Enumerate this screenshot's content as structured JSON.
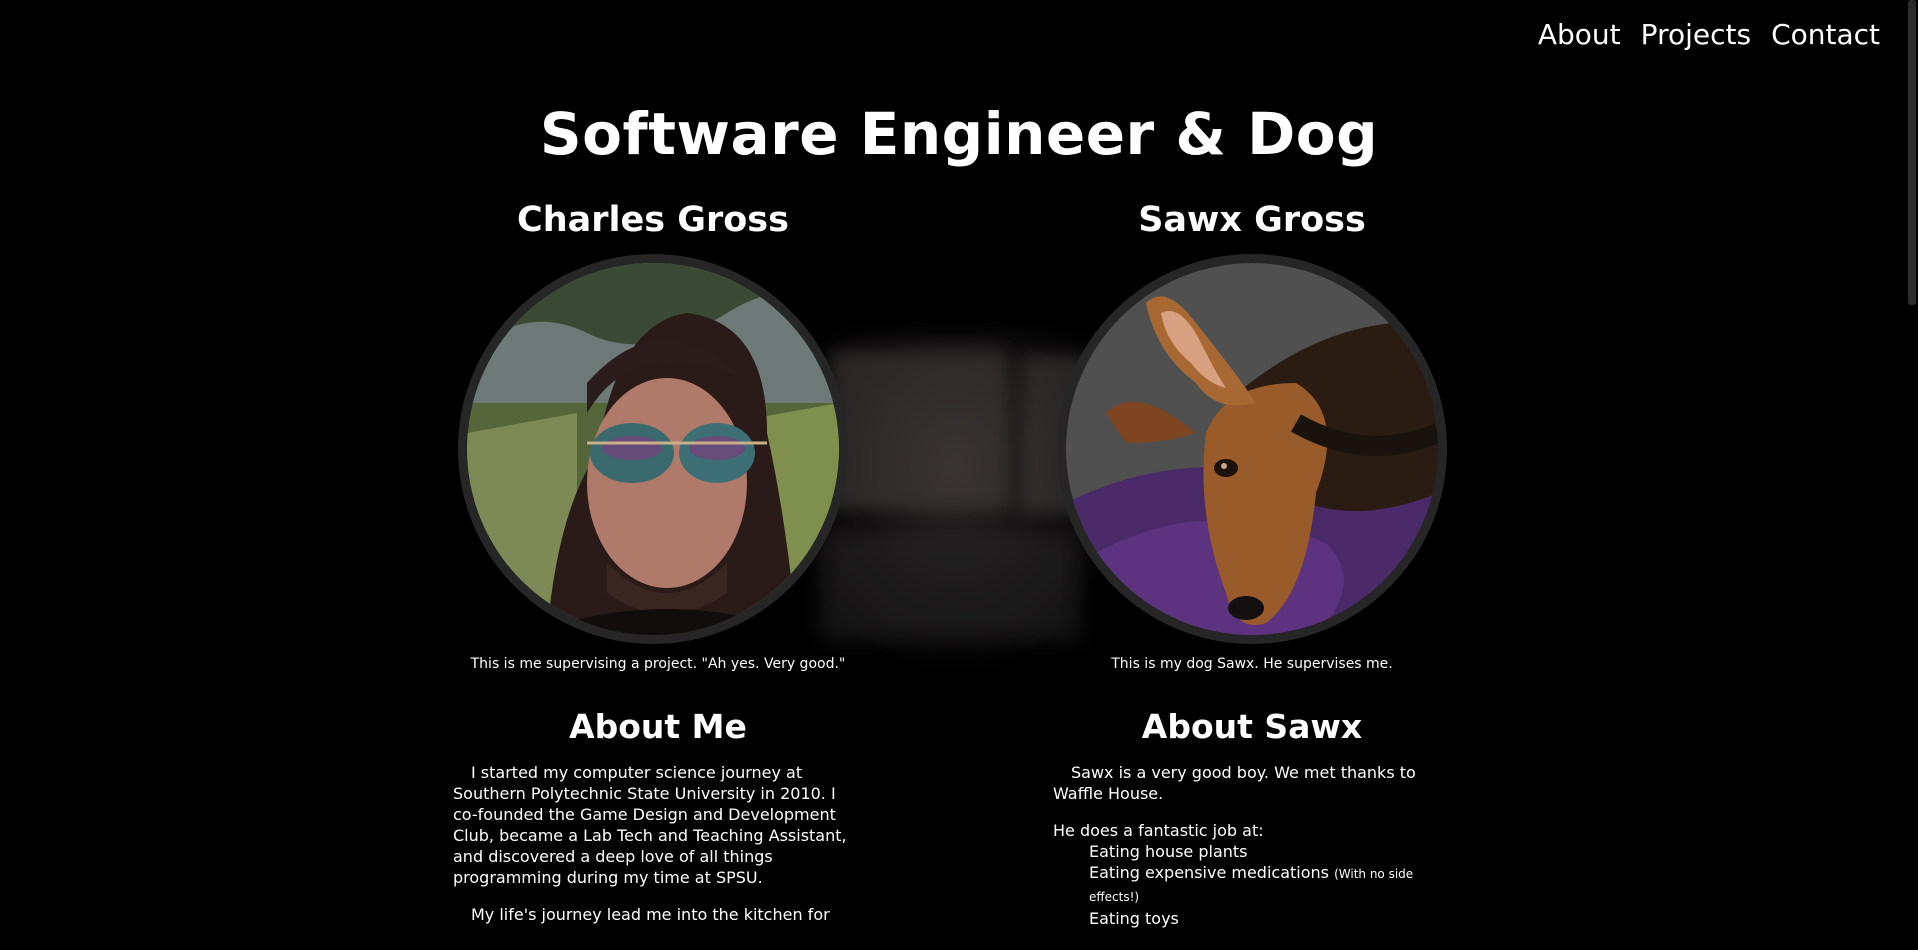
{
  "nav": {
    "links": [
      "About",
      "Projects",
      "Contact"
    ]
  },
  "hero": {
    "title": "Software Engineer & Dog"
  },
  "left": {
    "name": "Charles Gross",
    "caption": "This is me supervising a project. \"Ah yes. Very good.\"",
    "heading": "About Me",
    "paragraphs": [
      "I started my computer science journey at Southern Polytechnic State University in 2010. I co-founded the Game Design and Development Club, became a Lab Tech and Teaching Assistant, and discovered a deep love of all things programming during my time at SPSU.",
      "My life's journey lead me into the kitchen for"
    ]
  },
  "right": {
    "name": "Sawx Gross",
    "caption": "This is my dog Sawx. He supervises me.",
    "heading": "About Sawx",
    "paragraph": "Sawx is a very good boy. We met thanks to Waffle House.",
    "list_intro": "He does a fantastic job at:",
    "list": [
      {
        "text": "Eating house plants",
        "note": ""
      },
      {
        "text": "Eating expensive medications",
        "note": "(With no side effects!)"
      },
      {
        "text": "Eating toys",
        "note": ""
      }
    ]
  },
  "colors": {
    "background": "#000000",
    "text": "#ffffff",
    "portrait_ring": "#262626"
  }
}
